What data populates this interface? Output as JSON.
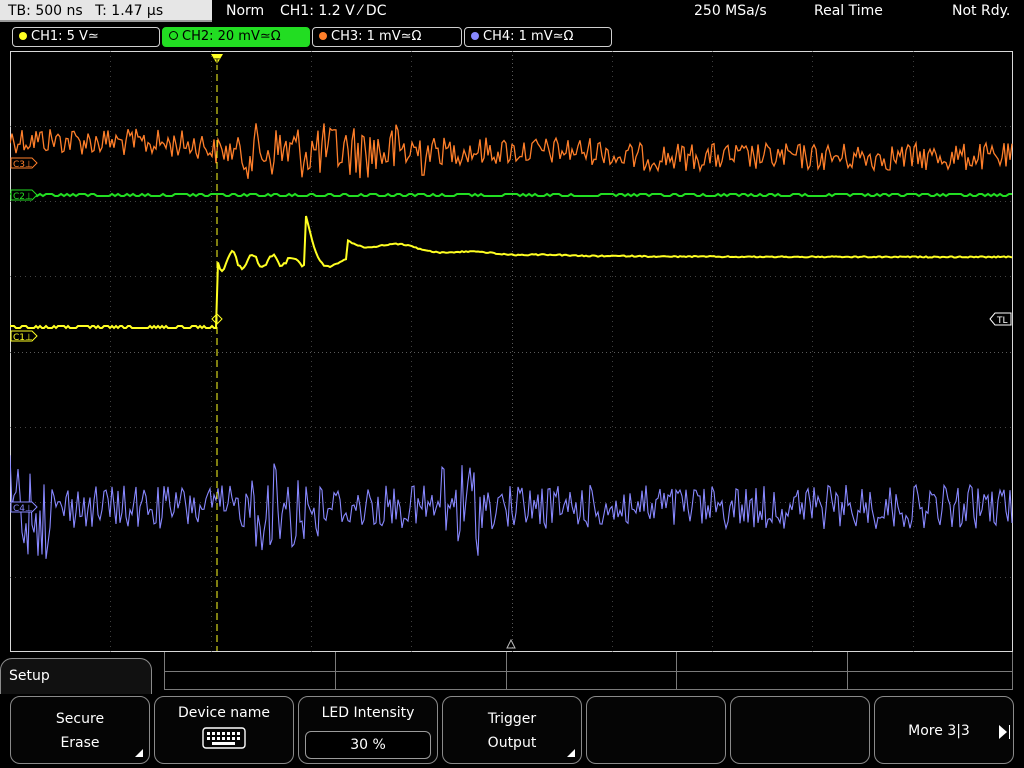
{
  "topbar": {
    "timebase": "TB: 500 ns",
    "trigger_time": "T: 1.47 µs",
    "mode": "Norm",
    "trigger_setting": "CH1: 1.2 V ⁄ DC",
    "sample_rate": "250 MSa/s",
    "acq_mode": "Real Time",
    "status": "Not Rdy."
  },
  "channels": [
    {
      "label": "CH1: 5 V≃",
      "color": "#ffff22",
      "active": false
    },
    {
      "label": "CH2: 20 mV≃Ω",
      "color": "#22dd22",
      "active": true
    },
    {
      "label": "CH3: 1 mV≃Ω",
      "color": "#ff7f2a",
      "active": false
    },
    {
      "label": "CH4: 1 mV≃Ω",
      "color": "#8888ff",
      "active": false
    }
  ],
  "markers": {
    "c3": "C3⊥",
    "c2": "C2⊥",
    "c1": "C1⊥",
    "c4": "C4⊥",
    "trigger_level": "TL",
    "trigger_pos": "T"
  },
  "setup": {
    "title": "Setup"
  },
  "softkeys": {
    "secure_erase": {
      "line1": "Secure",
      "line2": "Erase"
    },
    "device_name": {
      "label": "Device name",
      "icon": "keyboard-icon"
    },
    "led_intensity": {
      "label": "LED Intensity",
      "value": "30 %"
    },
    "trigger_output": {
      "line1": "Trigger",
      "line2": "Output"
    },
    "more": {
      "label": "More 3|3"
    }
  },
  "colors": {
    "ch1": "#ffff22",
    "ch2": "#22dd22",
    "ch3": "#ff7f2a",
    "ch4": "#8888ff",
    "grid": "#5a5a5a"
  }
}
